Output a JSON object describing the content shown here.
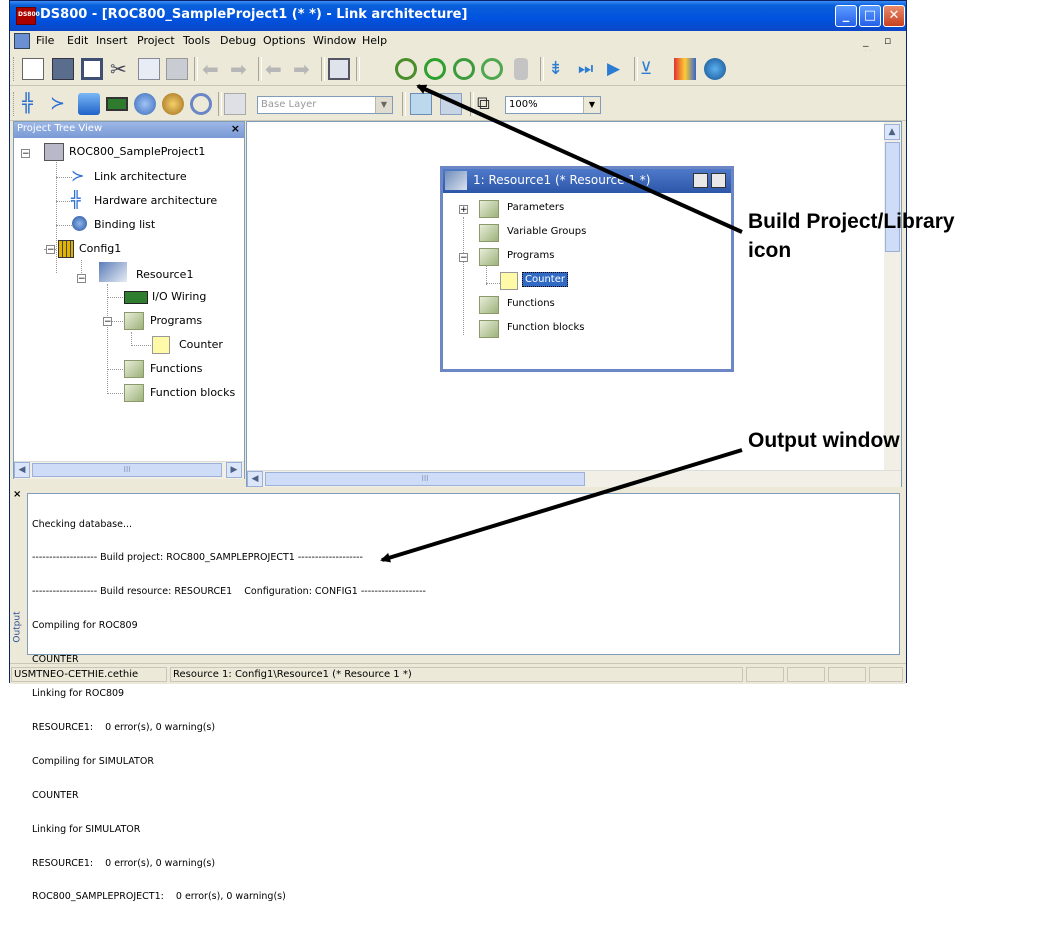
{
  "window": {
    "title": "DS800 - [ROC800_SampleProject1 (*  *) - Link architecture]",
    "minimize": "_",
    "maximize": "□",
    "close": "✕"
  },
  "menu": [
    {
      "label": "File"
    },
    {
      "label": "Edit"
    },
    {
      "label": "Insert"
    },
    {
      "label": "Project"
    },
    {
      "label": "Tools"
    },
    {
      "label": "Debug"
    },
    {
      "label": "Options"
    },
    {
      "label": "Window"
    },
    {
      "label": "Help"
    }
  ],
  "mdi_controls": "_ ▫ ×",
  "toolbar2": {
    "layer_combo": "Base Layer",
    "zoom_combo": "100%"
  },
  "tree": {
    "header": "Project Tree View",
    "close": "×",
    "project": "ROC800_SampleProject1",
    "link_architecture": "Link architecture",
    "hardware_architecture": "Hardware architecture",
    "binding_list": "Binding list",
    "config": "Config1",
    "resource": "Resource1",
    "io_wiring": "I/O Wiring",
    "programs": "Programs",
    "counter": "Counter",
    "functions": "Functions",
    "function_blocks": "Function blocks",
    "scroll_thumb": "III"
  },
  "resource_window": {
    "title": "1: Resource1 (* Resource 1 *)",
    "items": {
      "parameters": "Parameters",
      "variable_groups": "Variable Groups",
      "programs": "Programs",
      "counter": "Counter",
      "functions": "Functions",
      "function_blocks": "Function blocks"
    }
  },
  "output": {
    "close": "×",
    "side_label": "Output",
    "lines": [
      "Checking database...",
      "------------------- Build project: ROC800_SAMPLEPROJECT1 -------------------",
      "------------------- Build resource: RESOURCE1    Configuration: CONFIG1 -------------------",
      "Compiling for ROC809",
      "COUNTER",
      "Linking for ROC809",
      "RESOURCE1:    0 error(s), 0 warning(s)",
      "Compiling for SIMULATOR",
      "COUNTER",
      "Linking for SIMULATOR",
      "RESOURCE1:    0 error(s), 0 warning(s)",
      "ROC800_SAMPLEPROJECT1:    0 error(s), 0 warning(s)"
    ]
  },
  "statusbar": {
    "user": "USMTNEO-CETHIE.cethie",
    "location": "Resource 1: Config1\\Resource1 (* Resource 1 *)"
  },
  "callouts": {
    "build_line1": "Build Project/Library",
    "build_line2": "icon",
    "output": "Output window"
  },
  "colors": {
    "titlebar": "#0053e0",
    "window_bg": "#ece9d8",
    "selection": "#316ac5"
  }
}
